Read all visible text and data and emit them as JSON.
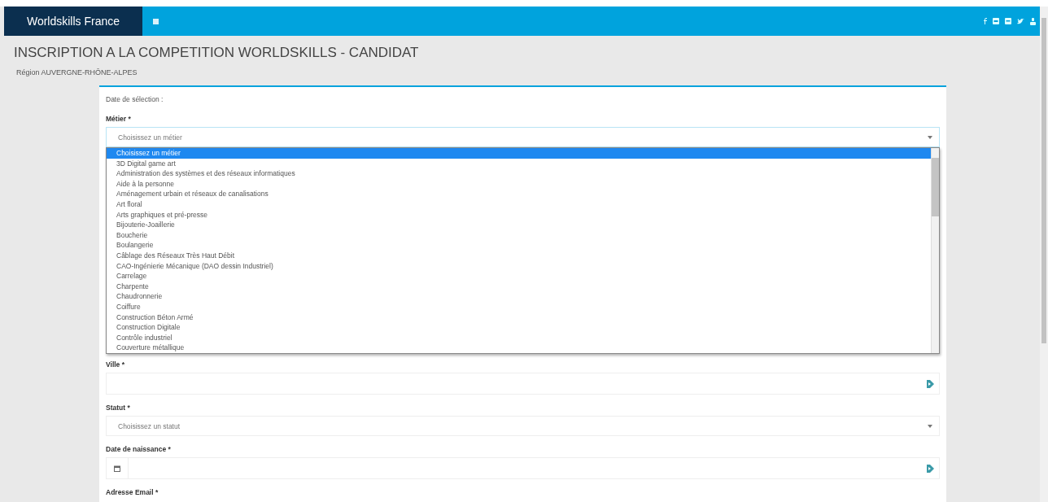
{
  "navbar": {
    "brand": "Worldskills France"
  },
  "page": {
    "title": "INSCRIPTION A LA COMPETITION WORLDSKILLS - CANDIDAT",
    "region": "Région AUVERGNE-RHÔNE-ALPES"
  },
  "form": {
    "selection_date_label": "Date de sélection :",
    "fields": [
      {
        "kind": "select",
        "label": "Métier *",
        "value": "Choisissez un métier",
        "expanded": true,
        "options": [
          {
            "label": "Choisissez un métier",
            "selected": true
          },
          {
            "label": "3D Digital game art",
            "selected": false
          },
          {
            "label": "Administration des systèmes et des réseaux informatiques",
            "selected": false
          },
          {
            "label": "Aide à la personne",
            "selected": false
          },
          {
            "label": "Aménagement urbain et réseaux de canalisations",
            "selected": false
          },
          {
            "label": "Art floral",
            "selected": false
          },
          {
            "label": "Arts graphiques et pré-presse",
            "selected": false
          },
          {
            "label": "Bijouterie-Joaillerie",
            "selected": false
          },
          {
            "label": "Boucherie",
            "selected": false
          },
          {
            "label": "Boulangerie",
            "selected": false
          },
          {
            "label": "Câblage des Réseaux Très Haut Débit",
            "selected": false
          },
          {
            "label": "CAO-Ingénierie Mécanique (DAO dessin Industriel)",
            "selected": false
          },
          {
            "label": "Carrelage",
            "selected": false
          },
          {
            "label": "Charpente",
            "selected": false
          },
          {
            "label": "Chaudronnerie",
            "selected": false
          },
          {
            "label": "Coiffure",
            "selected": false
          },
          {
            "label": "Construction Béton Armé",
            "selected": false
          },
          {
            "label": "Construction Digitale",
            "selected": false
          },
          {
            "label": "Contrôle industriel",
            "selected": false
          },
          {
            "label": "Couverture métallique",
            "selected": false
          }
        ]
      },
      {
        "kind": "input",
        "label": "Ville *"
      },
      {
        "kind": "select",
        "label": "Statut *",
        "value": "Choisissez un statut",
        "expanded": false
      },
      {
        "kind": "date",
        "label": "Date de naissance *"
      },
      {
        "kind": "label",
        "label": "Adresse Email *"
      }
    ]
  }
}
